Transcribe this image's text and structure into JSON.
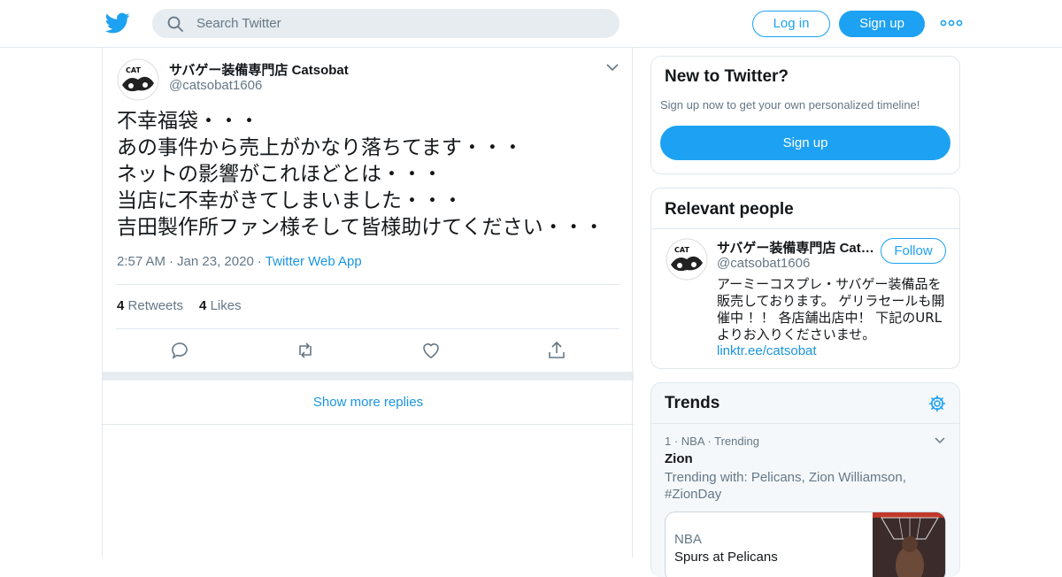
{
  "header": {
    "search_placeholder": "Search Twitter",
    "login_label": "Log in",
    "signup_label": "Sign up",
    "accent": "#1da1f2"
  },
  "tweet": {
    "author_name": "サバゲー装備専門店 Catsobat",
    "author_handle": "@catsobat1606",
    "lines": [
      "不幸福袋・・・",
      "あの事件から売上がかなり落ちてます・・・",
      "ネットの影響がこれほどとは・・・",
      "当店に不幸がきてしまいました・・・",
      "吉田製作所ファン様そして皆様助けてください・・・"
    ],
    "time": "2:57 AM",
    "date": "Jan 23, 2020",
    "source": "Twitter Web App",
    "retweets_count": "4",
    "retweets_label": "Retweets",
    "likes_count": "4",
    "likes_label": "Likes",
    "show_more": "Show more replies"
  },
  "new_to_twitter": {
    "title": "New to Twitter?",
    "subtitle": "Sign up now to get your own personalized timeline!",
    "button": "Sign up"
  },
  "relevant_people": {
    "title": "Relevant people",
    "name": "サバゲー装備専門店 Catsobat",
    "handle": "@catsobat1606",
    "follow_label": "Follow",
    "bio": "アーミーコスプレ・サバゲー装備品を販売しております。 ゲリラセールも開催中 ！！ 各店舗出店中！ 下記のURLよりお入りくださいませ。",
    "link": "linktr.ee/catsobat"
  },
  "trends": {
    "title": "Trends",
    "items": [
      {
        "rank": "1",
        "category": "NBA",
        "status": "Trending",
        "name": "Zion",
        "trending_with": "Trending with: Pelicans, Zion Williamson, #ZionDay",
        "news_category": "NBA",
        "news_headline": "Spurs at Pelicans"
      }
    ]
  }
}
